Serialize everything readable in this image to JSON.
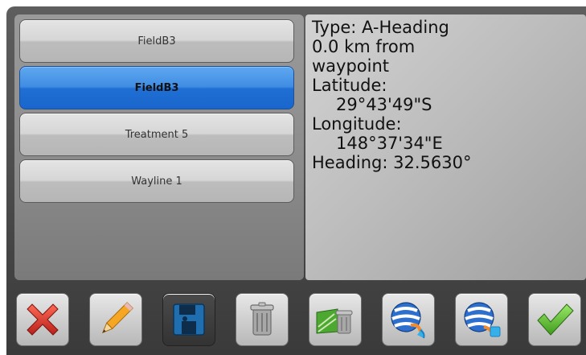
{
  "list": {
    "items": [
      {
        "label": "FieldB3",
        "selected": false
      },
      {
        "label": "FieldB3",
        "selected": true
      },
      {
        "label": "Treatment 5",
        "selected": false
      },
      {
        "label": "Wayline 1",
        "selected": false
      }
    ]
  },
  "details": {
    "type_line": "Type: A-Heading",
    "distance_line": "0.0 km from",
    "waypoint_line": "waypoint",
    "latitude_label": "Latitude:",
    "latitude_value": "29°43'49\"S",
    "longitude_label": "Longitude:",
    "longitude_value": "148°37'34\"E",
    "heading_line": "Heading: 32.5630°"
  },
  "toolbar": {
    "buttons": [
      {
        "icon": "red-x-icon"
      },
      {
        "icon": "pencil-icon"
      },
      {
        "icon": "floppy-disk-icon"
      },
      {
        "icon": "trash-can-icon"
      },
      {
        "icon": "field-trash-icon"
      },
      {
        "icon": "globe-export-icon"
      },
      {
        "icon": "globe-import-icon"
      },
      {
        "icon": "green-check-icon"
      }
    ]
  },
  "colors": {
    "selected_blue": "#2f7fdc",
    "cancel_red": "#d83a2a",
    "confirm_green": "#5cc22a"
  }
}
